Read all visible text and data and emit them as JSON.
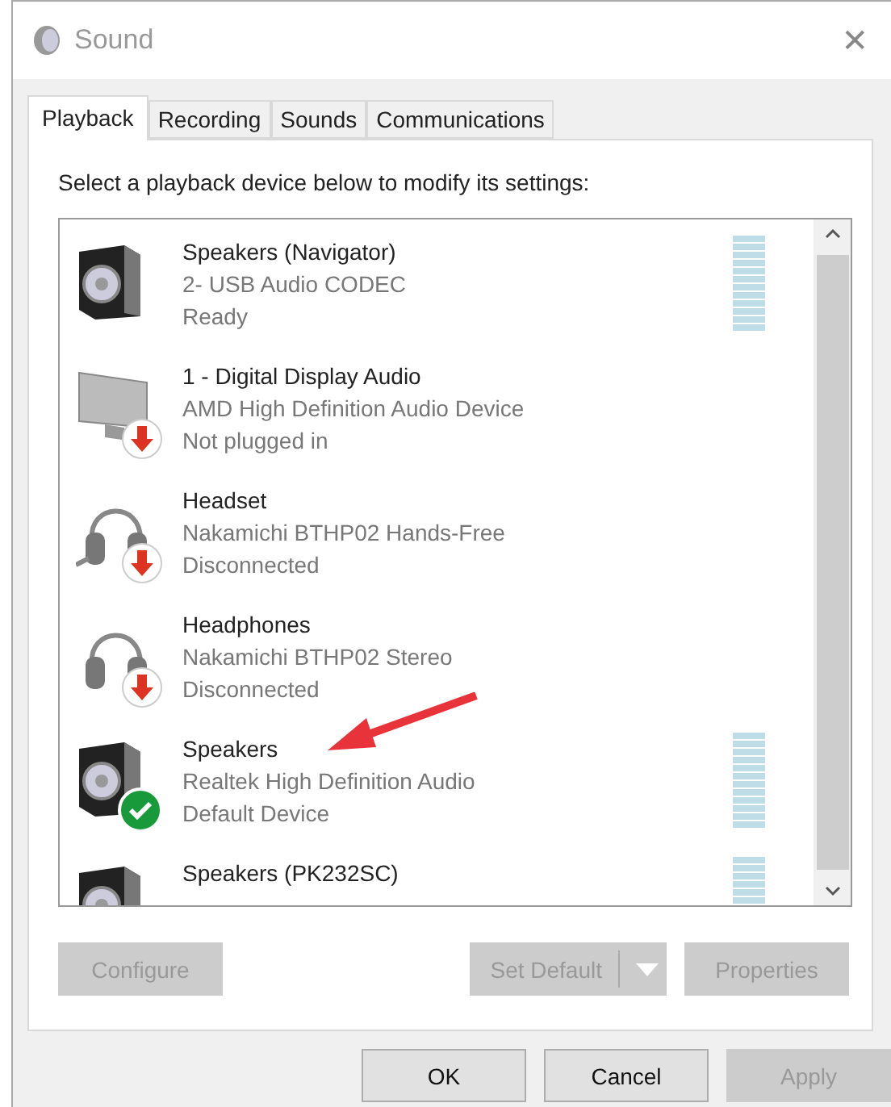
{
  "window": {
    "title": "Sound",
    "close": "✕"
  },
  "tabs": [
    {
      "label": "Playback",
      "selected": true
    },
    {
      "label": "Recording",
      "selected": false
    },
    {
      "label": "Sounds",
      "selected": false
    },
    {
      "label": "Communications",
      "selected": false
    }
  ],
  "instruction": "Select a playback device below to modify its settings:",
  "devices": [
    {
      "kind": "speaker",
      "unplugged": false,
      "default": false,
      "meter": true,
      "name": "Speakers (Navigator)",
      "driver": "2- USB Audio CODEC",
      "status": "Ready"
    },
    {
      "kind": "monitor",
      "unplugged": true,
      "default": false,
      "meter": false,
      "name": "1 - Digital Display Audio",
      "driver": "AMD High Definition Audio Device",
      "status": "Not plugged in"
    },
    {
      "kind": "headset",
      "unplugged": true,
      "default": false,
      "meter": false,
      "name": "Headset",
      "driver": "Nakamichi BTHP02 Hands-Free",
      "status": "Disconnected"
    },
    {
      "kind": "headphones",
      "unplugged": true,
      "default": false,
      "meter": false,
      "name": "Headphones",
      "driver": "Nakamichi BTHP02 Stereo",
      "status": "Disconnected"
    },
    {
      "kind": "speaker",
      "unplugged": false,
      "default": true,
      "meter": true,
      "name": "Speakers",
      "driver": "Realtek High Definition Audio",
      "status": "Default Device"
    },
    {
      "kind": "speaker",
      "unplugged": false,
      "default": false,
      "meter": true,
      "name": "Speakers (PK232SC)"
    }
  ],
  "device_buttons": [
    {
      "label": "Configure",
      "disabled": true
    },
    {
      "label": "Set Default",
      "disabled": true,
      "split": true
    },
    {
      "label": "Properties",
      "disabled": true
    }
  ],
  "dialog_buttons": [
    {
      "label": "OK",
      "disabled": false
    },
    {
      "label": "Cancel",
      "disabled": false
    },
    {
      "label": "Apply",
      "disabled": true
    }
  ]
}
